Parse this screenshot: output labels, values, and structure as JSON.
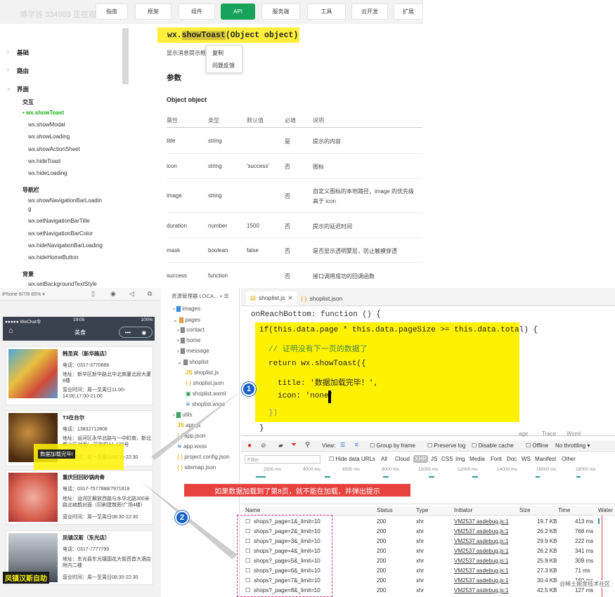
{
  "watermark": "博学谷 334903 正在观看视频",
  "topnav": [
    "指南",
    "框架",
    "组件",
    "API",
    "服务端",
    "工具",
    "云开发",
    "扩展"
  ],
  "sidebar": {
    "sections": [
      "基础",
      "路由",
      "界面"
    ],
    "groups": [
      "交互",
      "导航栏",
      "背景"
    ],
    "items": [
      "wx.showToast",
      "wx.showModal",
      "wx.showLoading",
      "wx.showActionSheet",
      "wx.hideToast",
      "wx.hideLoading",
      "wx.showNavigationBarLoadin",
      "g",
      "wx.setNavigationBarTitle",
      "wx.setNavigationBarColor",
      "wx.hideNavigationBarLoading",
      "wx.hideHomeButton",
      "wx.setBackgroundTextStyle"
    ]
  },
  "api": {
    "title_fn": "wx.",
    "title_hl": "showToast",
    "title_sig": "(Object object)",
    "desc": "显示消息提示框",
    "ctx_copy": "复制",
    "ctx_feedback": "问题反馈",
    "h_params": "参数",
    "h_obj": "Object object",
    "headers": [
      "属性",
      "类型",
      "默认值",
      "必填",
      "说明"
    ],
    "rows": [
      [
        "title",
        "string",
        "",
        "是",
        "提示的内容"
      ],
      [
        "icon",
        "string",
        "'success'",
        "否",
        "图标"
      ],
      [
        "image",
        "string",
        "",
        "否",
        "自定义图标的本地路径，image 的优先级",
        "高于 icon"
      ],
      [
        "duration",
        "number",
        "1500",
        "否",
        "提示的延迟时间"
      ],
      [
        "mask",
        "boolean",
        "false",
        "否",
        "是否显示透明蒙层，防止触摸穿透"
      ],
      [
        "success",
        "function",
        "",
        "否",
        "接口调用成功的回调函数"
      ]
    ]
  },
  "phone": {
    "model": "iPhone 6/7/8 85% ▾",
    "status_left": "●●●●● WeChat令",
    "status_time": "19:05",
    "status_right": "100%",
    "nav_title": "美食",
    "cards": [
      {
        "title": "韩圣宾（新华路店）",
        "phone": "电话：0317-3770888",
        "addr": "地址：新华区新华路北华北商厦北段大厦8楼",
        "hours": "营业时间：周一至周日11:00-14:00;17:00-21:00"
      },
      {
        "title": "T3在台尔",
        "phone": "电话：13832712808",
        "addr": "地址：运河区永华北路与一中町南，新北都小区对面/一区别府A1-128号",
        "hours": "营业时间：周一至周日08:30-22:30"
      },
      {
        "title": "重庆回回砂锅肉骨",
        "phone": "电话：0317-7577888/7971818",
        "addr": "地址：运河区解放西路与水华北路300米路北格鹊对面（印刷建筑旁/广场4楼）",
        "hours": "营业时间：周一至周日08:30-22:30"
      },
      {
        "title": "凤镇汉斯（东光店）",
        "phone": "电话：0317-7777799",
        "addr": "地址：东光县东光镇国花大街西首大酒店附内二楼",
        "hours": "营业时间：周一至周日08:30-22:30"
      }
    ],
    "overlay1": "数据加载完毕!",
    "overlay2": "凤镇汉斯自助"
  },
  "filetree": {
    "header": "资源管理器  LOCA...  +  ☰",
    "items": [
      "images",
      "pages",
      "contact",
      "home",
      "message",
      "shoplist",
      "shoplist.js",
      "shoplist.json",
      "shoplist.wxml",
      "shoplist.wxss",
      "utils",
      "app.js",
      "app.json",
      "app.wxss",
      "project.config.json",
      "sitemap.json"
    ]
  },
  "editor": {
    "tab1": "shoplist.js",
    "tab2": "shoplist.json",
    "lines": [
      "onReachBottom: function () {",
      "if(this.data.page * this.data.pageSize >= this.data.total) {",
      "// 证明没有下一页的数据了",
      "return wx.showToast({",
      "title: '数据加载完毕！',",
      "icon: 'none'",
      "})",
      "}"
    ]
  },
  "devtools": {
    "tabs": [
      "age",
      "Trace",
      "Wxml"
    ],
    "toolbar": [
      "View:",
      "Group by frame",
      "Preserve log",
      "Disable cache",
      "Offline",
      "No throttling"
    ],
    "filter": "Filter",
    "filter_opts": [
      "Hide data URLs",
      "All",
      "Cloud",
      "XHR",
      "JS",
      "CSS",
      "Img",
      "Media",
      "Font",
      "Doc",
      "WS",
      "Manifest",
      "Other"
    ],
    "timeline": [
      "2000 ms",
      "4000 ms",
      "6000 ms",
      "8000 ms",
      "10000 ms",
      "12000 ms",
      "14000 ms",
      "16000 ms",
      "18000 ms"
    ],
    "annotation": "如果数据加载到了第8页，就不能在加载，并弹出提示",
    "headers": [
      "Name",
      "Status",
      "Type",
      "Initiator",
      "Size",
      "Time",
      "Water"
    ],
    "rows": [
      [
        "shops?_page=1&_limit=10",
        "200",
        "xhr",
        "VM2537 asdebug.js:1",
        "19.7 KB",
        "413 ms"
      ],
      [
        "shops?_page=2&_limit=10",
        "200",
        "xhr",
        "VM2537 asdebug.js:1",
        "26.2 KB",
        "768 ms"
      ],
      [
        "shops?_page=3&_limit=10",
        "200",
        "xhr",
        "VM2537 asdebug.js:1",
        "29.9 KB",
        "222 ms"
      ],
      [
        "shops?_page=4&_limit=10",
        "200",
        "xhr",
        "VM2537 asdebug.js:1",
        "26.2 KB",
        "341 ms"
      ],
      [
        "shops?_page=5&_limit=10",
        "200",
        "xhr",
        "VM2537 asdebug.js:1",
        "25.9 KB",
        "309 ms"
      ],
      [
        "shops?_page=6&_limit=10",
        "200",
        "xhr",
        "VM2537 asdebug.js:1",
        "27.3 KB",
        "71 ms"
      ],
      [
        "shops?_page=7&_limit=10",
        "200",
        "xhr",
        "VM2537 asdebug.js:1",
        "30.4 KB",
        "160 ms"
      ],
      [
        "shops?_page=8&_limit=10",
        "200",
        "xhr",
        "VM2537 asdebug.js:1",
        "42.5 KB",
        "127 ms"
      ]
    ],
    "footer": "@稀土掘金技术社区"
  },
  "badges": [
    "1",
    "2"
  ],
  "colors": {
    "accent": "#18a35a",
    "highlight": "#fff200",
    "annotation_bg": "#e8423f",
    "badge": "#1a62c9"
  }
}
